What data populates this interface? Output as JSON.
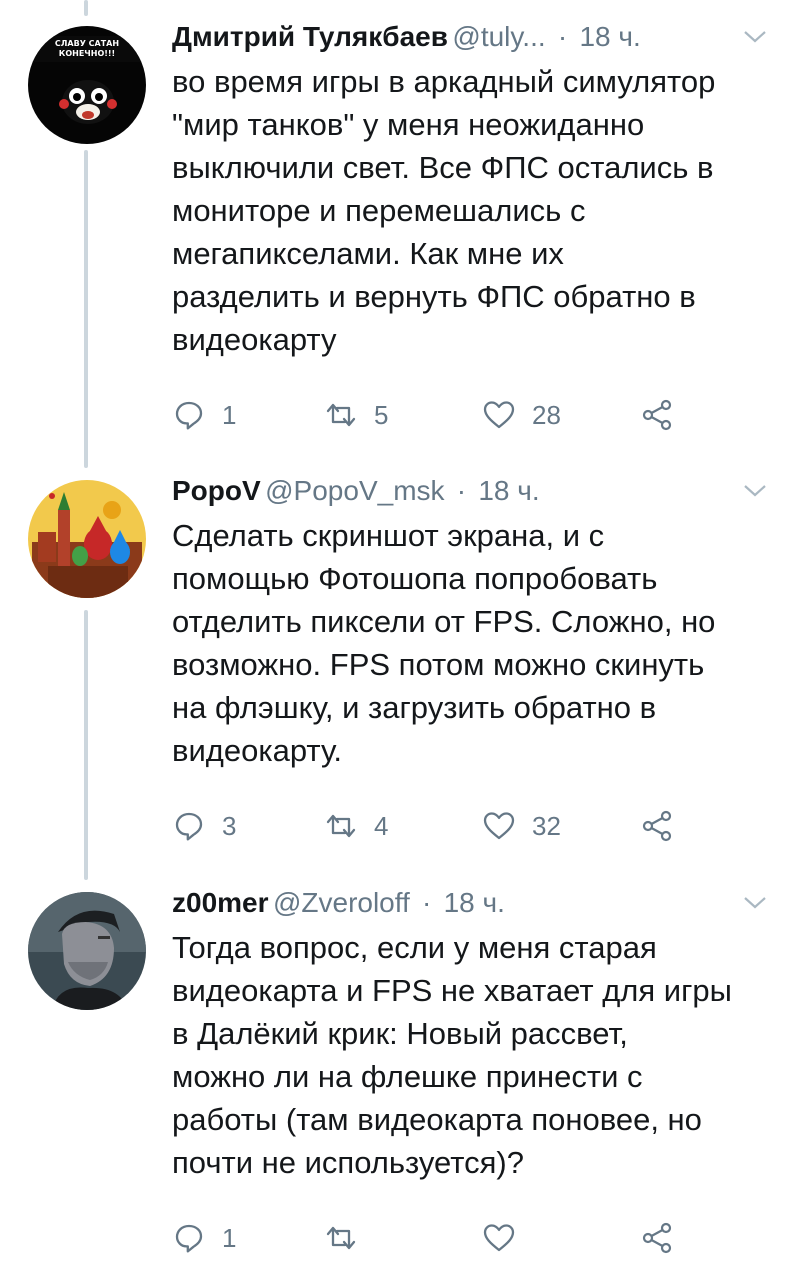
{
  "tweets": [
    {
      "name": "Дмитрий Тулякбаев",
      "handle": "@tuly...",
      "time": "18 ч.",
      "avatar_text_line1": "СЛАВУ САТАН",
      "avatar_text_line2": "КОНЕЧНО!!!",
      "lines": [
        "во время игры в аркадный симулятор",
        "\"мир танков\" у меня неожиданно",
        "выключили свет. Все ФПС остались в",
        "мониторе и перемешались с",
        "мегапикселами. Как мне их",
        "разделить и вернуть ФПС обратно в",
        "видеокарту"
      ],
      "replies": "1",
      "retweets": "5",
      "likes": "28"
    },
    {
      "name": "PopoV",
      "handle": "@PopoV_msk",
      "time": "18 ч.",
      "lines": [
        "Сделать скриншот экрана, и с",
        "помощью Фотошопа попробовать",
        "отделить пиксели от FPS. Сложно, но",
        "возможно. FPS потом можно скинуть",
        "на флэшку, и загрузить обратно в",
        "видеокарту."
      ],
      "replies": "3",
      "retweets": "4",
      "likes": "32"
    },
    {
      "name": "z00mer",
      "handle": "@Zveroloff",
      "time": "18 ч.",
      "lines": [
        "Тогда вопрос, если у меня старая",
        "видеокарта и FPS не хватает для игры",
        "в Далёкий крик: Новый рассвет,",
        "можно ли на флешке принести с",
        "работы (там видеокарта поновее, но",
        "почти не используется)?"
      ],
      "replies": "1",
      "retweets": "",
      "likes": ""
    }
  ],
  "colors": {
    "text": "#14171a",
    "secondary": "#657786",
    "thread_line": "#ccd6dd"
  }
}
